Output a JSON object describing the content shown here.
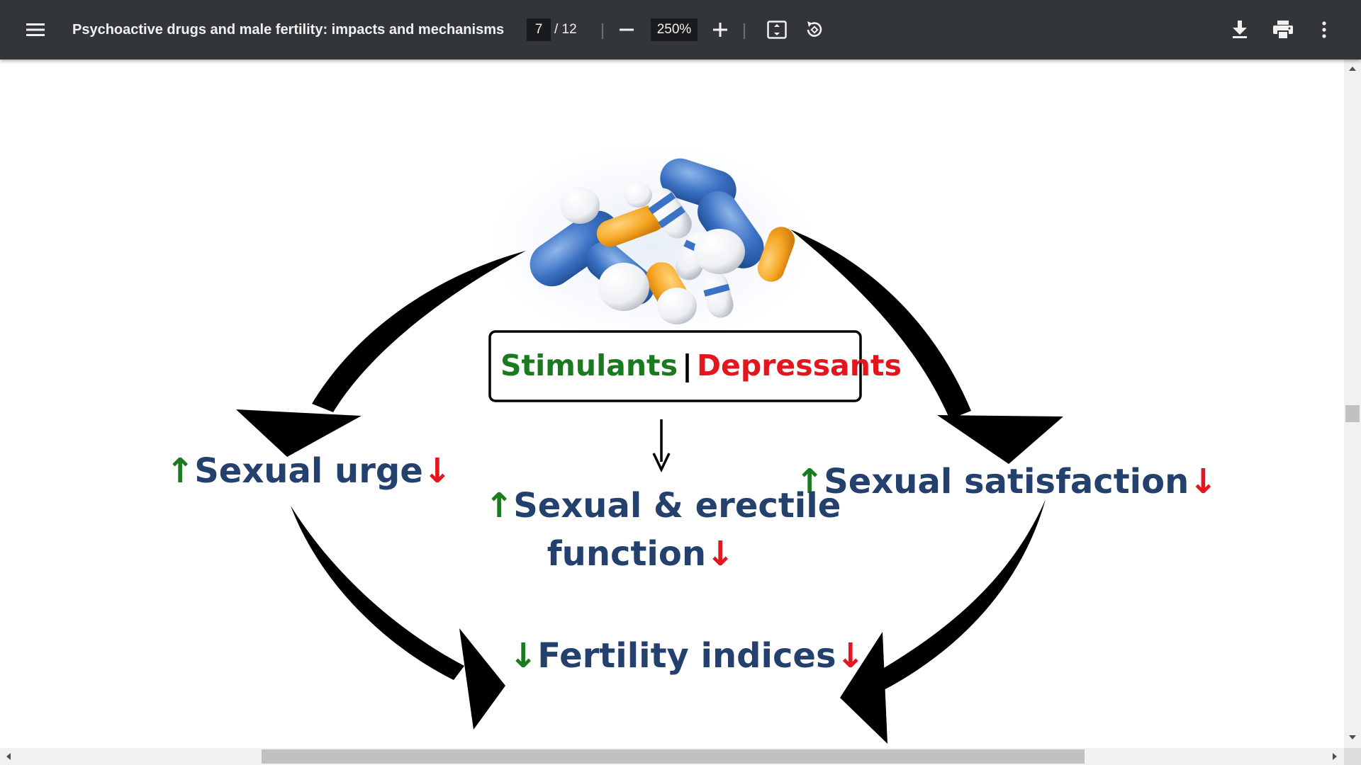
{
  "toolbar": {
    "title": "Psychoactive drugs and male fertility: impacts and mechanisms",
    "page_current": "7",
    "page_total": "/ 12",
    "zoom": "250%",
    "icons": {
      "menu": "menu-icon",
      "zoom_out": "minus-icon",
      "zoom_in": "plus-icon",
      "fit": "fit-page-icon",
      "rotate": "rotate-icon",
      "download": "download-icon",
      "print": "print-icon",
      "more": "more-vert-icon"
    }
  },
  "figure": {
    "box_left": "Stimulants",
    "box_divider": "|",
    "box_right": "Depressants",
    "up_arrow": "↑",
    "down_arrow": "↓",
    "sexual_urge": "Sexual urge",
    "sexual_function_line1": "Sexual & erectile",
    "sexual_function_line2": "function",
    "sexual_satisfaction": "Sexual satisfaction",
    "fertility_indices": "Fertility indices"
  },
  "colors": {
    "toolbar_bg": "#323639",
    "stimulant_green": "#1a7a1f",
    "depressant_red": "#e3151d",
    "label_navy": "#24406d"
  }
}
